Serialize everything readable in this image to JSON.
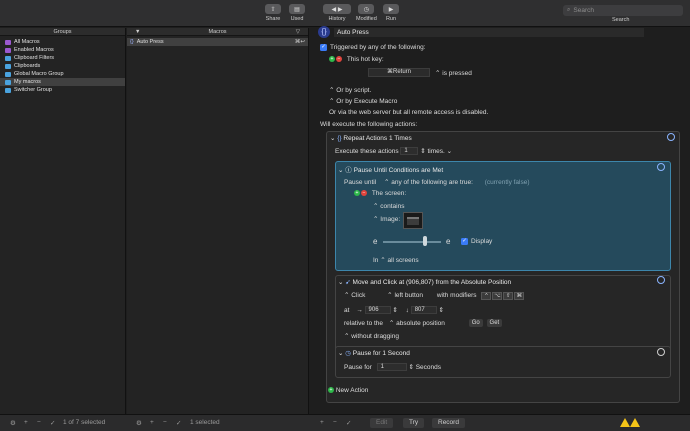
{
  "toolbar": {
    "share": "Share",
    "used": "Used",
    "history": "History",
    "modified": "Modified",
    "run": "Run",
    "search_placeholder": "Search",
    "search_label": "Search"
  },
  "groups": {
    "header": "Groups",
    "items": [
      {
        "label": "All Macros",
        "color": "#9b59d0"
      },
      {
        "label": "Enabled Macros",
        "color": "#9b59d0"
      },
      {
        "label": "Clipboard Filters",
        "color": "#4aa3df"
      },
      {
        "label": "Clipboards",
        "color": "#4aa3df"
      },
      {
        "label": "Global Macro Group",
        "color": "#4aa3df"
      },
      {
        "label": "My macros",
        "color": "#4aa3df"
      },
      {
        "label": "Switcher Group",
        "color": "#4aa3df"
      }
    ]
  },
  "macros": {
    "header": "Macros",
    "item": "Auto Press",
    "hotkey": "⌘↩"
  },
  "editor": {
    "macro_name": "Auto Press",
    "triggered": "Triggered by any of the following:",
    "this_hot_key": "This hot key:",
    "hotkey_value": "⌘Return",
    "is_pressed": "is pressed",
    "or_by_script": "Or by script.",
    "or_by_execute": "Or by Execute Macro",
    "or_via_web": "Or via the web server but all remote access is disabled.",
    "will_execute": "Will execute the following actions:",
    "repeat_title": "Repeat Actions 1 Times",
    "execute_these": "Execute these actions",
    "repeat_count": "1",
    "times": "times.",
    "pause_until_title": "Pause Until Conditions are Met",
    "pause_until": "Pause until",
    "any_of_following": "any of the following are true:",
    "currently_false": "(currently false)",
    "the_screen": "The screen:",
    "contains": "contains",
    "image": "Image:",
    "display": "Display",
    "in": "In",
    "all_screens": "all screens",
    "move_click_title": "Move and Click at (906,807) from the Absolute Position",
    "click": "Click",
    "left_button": "left button",
    "with_modifiers": "with modifiers",
    "modifiers": [
      "^",
      "⌥",
      "⇧",
      "⌘"
    ],
    "at": "at",
    "x_val": "906",
    "y_val": "807",
    "relative_to": "relative to the",
    "absolute_position": "absolute position",
    "go": "Go",
    "get": "Get",
    "without_dragging": "without dragging",
    "pause_title": "Pause for 1 Second",
    "pause_for": "Pause for",
    "pause_val": "1",
    "seconds": "Seconds",
    "new_action": "New Action"
  },
  "bottom": {
    "groups_count": "1 of 7 selected",
    "macros_count": "1 selected",
    "edit": "Edit",
    "try": "Try",
    "record": "Record"
  }
}
